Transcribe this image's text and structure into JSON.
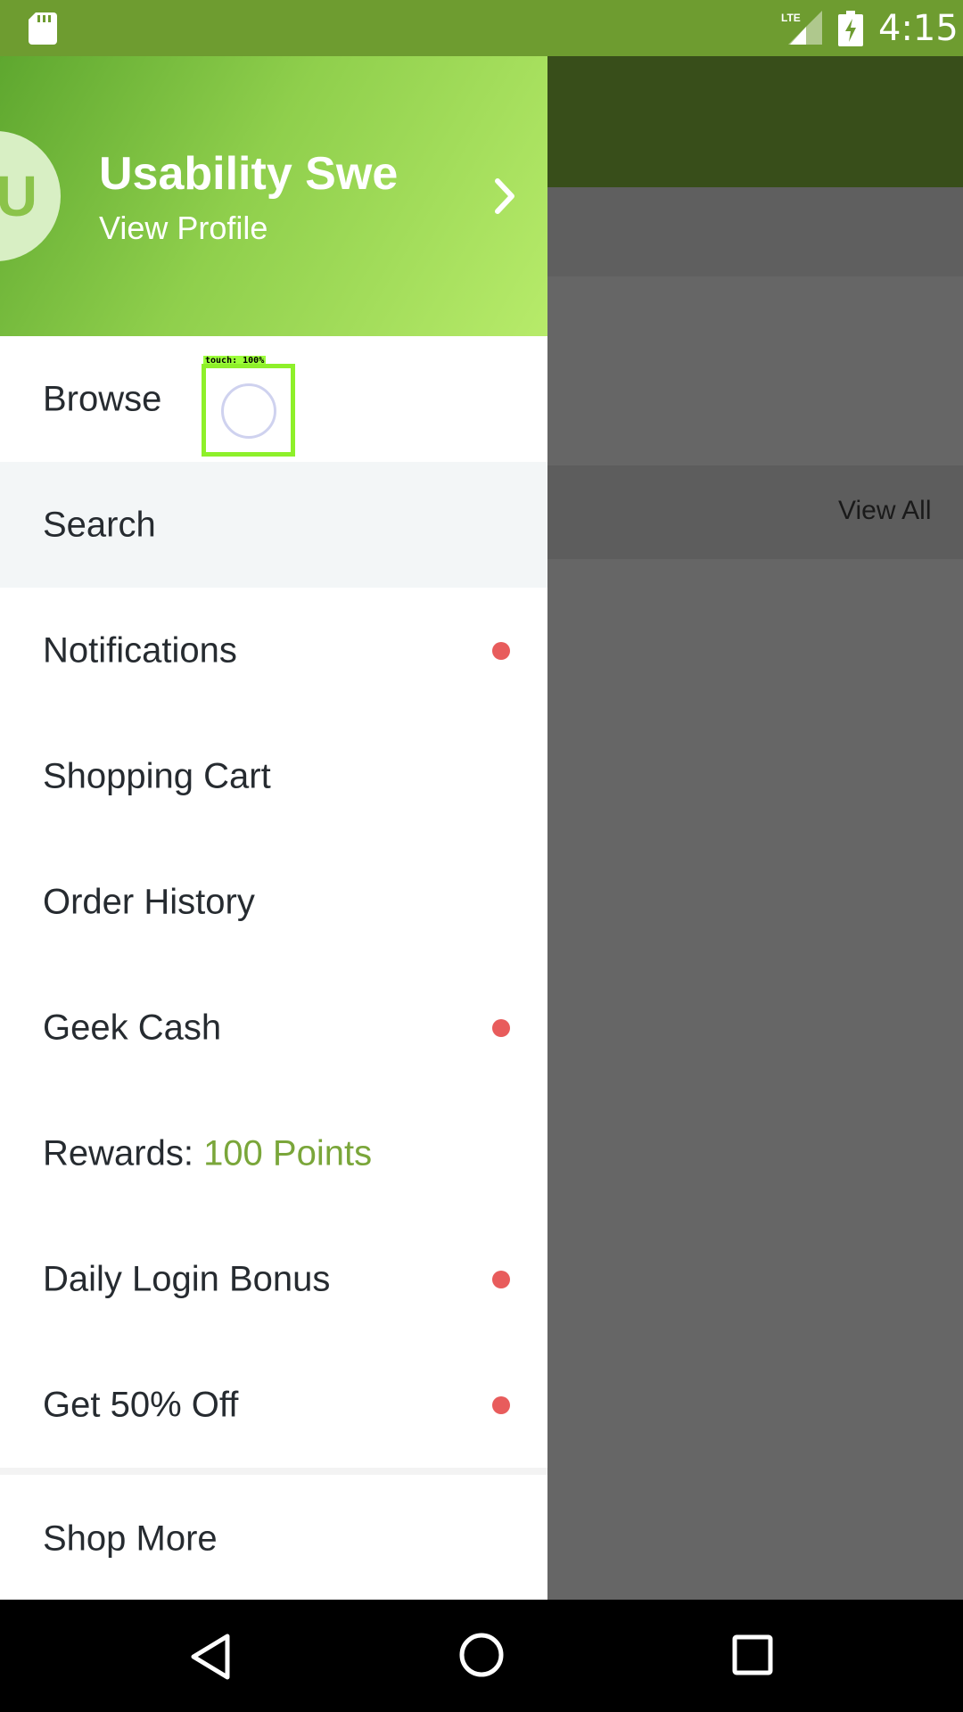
{
  "status_bar": {
    "time": "4:15",
    "network": "LTE",
    "icons": [
      "sd-card-icon",
      "lte-signal-icon",
      "battery-charging-icon"
    ],
    "color": "#6e9c30"
  },
  "background_screen": {
    "view_all_label": "View All"
  },
  "drawer": {
    "header": {
      "avatar_initial": "U",
      "user_name": "Usability Swe",
      "view_profile_label": "View Profile"
    },
    "items": [
      {
        "label": "Browse",
        "selected": false,
        "badge": false
      },
      {
        "label": "Search",
        "selected": true,
        "badge": false
      },
      {
        "label": "Notifications",
        "selected": false,
        "badge": true
      },
      {
        "label": "Shopping Cart",
        "selected": false,
        "badge": false
      },
      {
        "label": "Order History",
        "selected": false,
        "badge": false
      },
      {
        "label": "Geek Cash",
        "selected": false,
        "badge": true
      },
      {
        "label": "Rewards: ",
        "points": "100 Points",
        "selected": false,
        "badge": false
      },
      {
        "label": "Daily Login Bonus",
        "selected": false,
        "badge": true
      },
      {
        "label": "Get 50% Off",
        "selected": false,
        "badge": true
      }
    ],
    "footer_item": {
      "label": "Shop More"
    },
    "badge_color": "#e85c5c",
    "accent_color": "#7aa63a"
  },
  "touch_overlay": {
    "label": "touch: 100%"
  },
  "nav_bar": {
    "icons": [
      "back-icon",
      "home-icon",
      "recent-apps-icon"
    ]
  }
}
